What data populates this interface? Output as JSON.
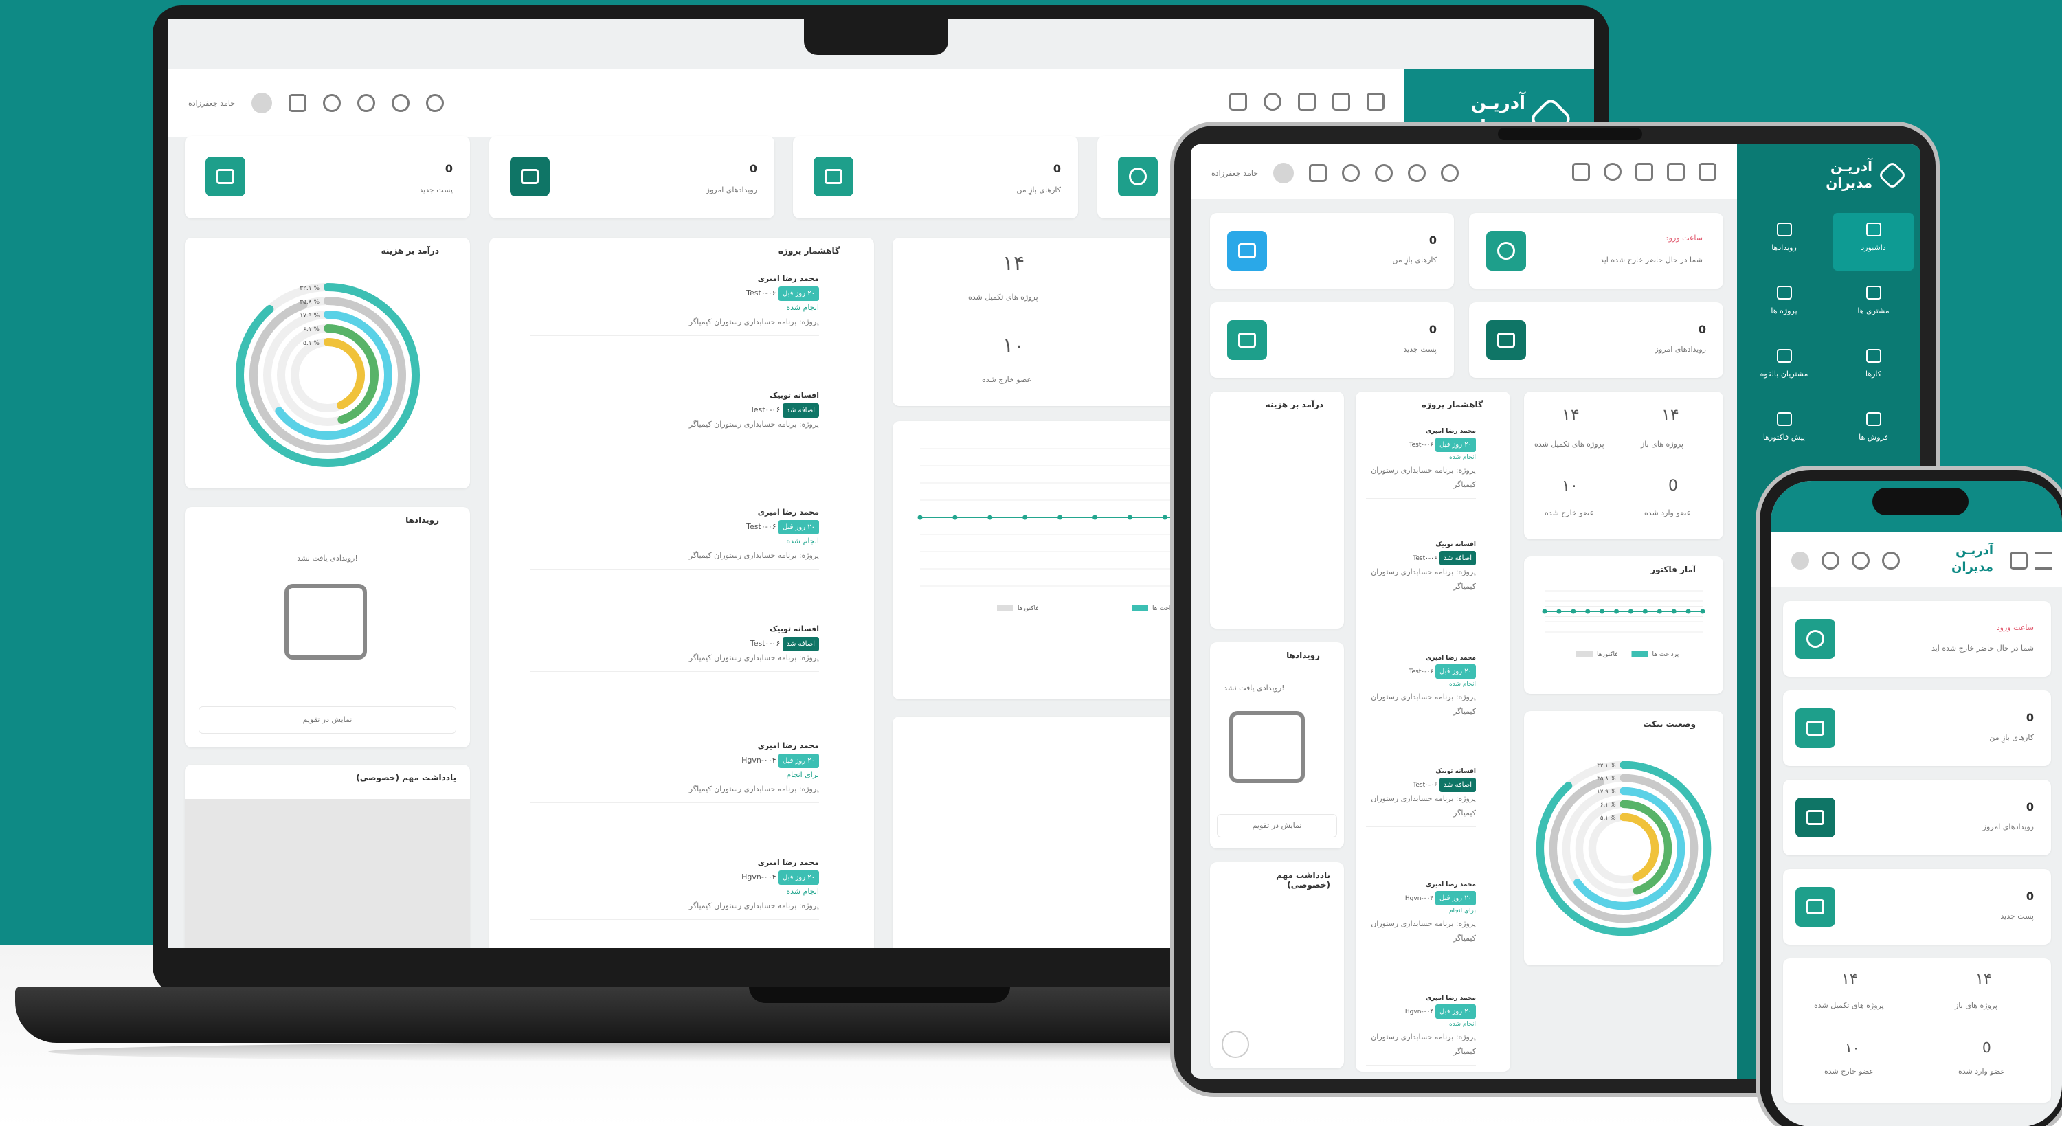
{
  "brand": {
    "name_line1": "آدریـن",
    "name_line2": "مدیران"
  },
  "user": {
    "name": "حامد جعفرزاده"
  },
  "cards": {
    "checkin_title": "ساعت ورود",
    "checkin_subtitle": "شما در حال حاضر خارج شده اید",
    "tasks_label": "کارهای بازِ من",
    "tasks_value": "0",
    "events_label": "رویدادهای امروز",
    "events_value": "0",
    "new_posts_label": "پست جدید",
    "new_posts_value": "0"
  },
  "stats": {
    "completed_label": "پروژه های تکمیل شده",
    "completed_value": "۱۴",
    "open_label": "پروژه های باز",
    "open_value": "۱۴",
    "left_label": "عضو خارج شده",
    "left_value": "۱۰",
    "joined_label": "عضو وارد شده",
    "joined_value": "0"
  },
  "panels": {
    "income_title": "درآمد بر هزینه",
    "activity_title": "گاهشمار پروژه",
    "events_title": "رویدادها",
    "events_empty": "رویدادی یافت نشد!",
    "calendar_link": "نمایش در تقویم",
    "notes_title": "یادداشت مهم (خصوصی)",
    "invoice_title": "آمار فاکتور",
    "ticket_title": "وضعیت تیکت"
  },
  "ring_chart": {
    "labels": [
      "۳۲.۱ %",
      "۳۵.۸ %",
      "۱۷.۹ %",
      "۶.۱ %",
      "۵.۱ %"
    ],
    "values": [
      32.1,
      35.8,
      17.9,
      6.1,
      5.1
    ],
    "colors": [
      "#3cbfb3",
      "#c9c9c9",
      "#5ad1e6",
      "#58b368",
      "#f0c23a"
    ]
  },
  "activity": [
    {
      "name": "محمد رضا امیری",
      "task": "Test۰-۰۶",
      "badge": "۲۰ روز قبل",
      "status": "انجام شده",
      "project": "پروژه: برنامه حسابداری رستوران کیمیاگر"
    },
    {
      "name": "افسانه توبیک",
      "task": "Test۰-۰۶",
      "badge": "اضافه شد",
      "status": "",
      "project": "پروژه: برنامه حسابداری رستوران کیمیاگر"
    },
    {
      "name": "محمد رضا امیری",
      "task": "Test۰-۰۶",
      "badge": "۲۰ روز قبل",
      "status": "انجام شده",
      "project": "پروژه: برنامه حسابداری رستوران کیمیاگر"
    },
    {
      "name": "افسانه توبیک",
      "task": "Test۰-۰۶",
      "badge": "اضافه شد",
      "status": "",
      "project": "پروژه: برنامه حسابداری رستوران کیمیاگر"
    },
    {
      "name": "محمد رضا امیری",
      "task": "Hgvn-۰۰۴",
      "badge": "۲۰ روز قبل",
      "status": "برای انجام",
      "project": "پروژه: برنامه حسابداری رستوران کیمیاگر"
    },
    {
      "name": "محمد رضا امیری",
      "task": "Hgvn-۰۰۴",
      "badge": "۲۰ روز قبل",
      "status": "انجام شده",
      "project": "پروژه: برنامه حسابداری رستوران کیمیاگر"
    }
  ],
  "sidebar": {
    "items": [
      {
        "label": "داشبورد",
        "icon": "monitor-icon"
      },
      {
        "label": "رویدادها",
        "icon": "calendar-icon"
      },
      {
        "label": "مشتری ها",
        "icon": "user-icon"
      },
      {
        "label": "پروژه ها",
        "icon": "folder-icon"
      },
      {
        "label": "کارها",
        "icon": "checklist-icon"
      },
      {
        "label": "مشتریان بالقوه",
        "icon": "users-icon"
      },
      {
        "label": "فروش ها",
        "icon": "cart-icon"
      },
      {
        "label": "پیش فاکتورها",
        "icon": "document-icon"
      }
    ]
  },
  "line_chart": {
    "type": "line",
    "values": [
      0,
      0,
      0,
      0,
      0,
      0,
      0,
      0,
      0,
      0,
      0,
      0
    ],
    "ylim": [
      -1,
      1
    ],
    "legend": [
      "پرداخت ها",
      "فاکتورها"
    ]
  }
}
